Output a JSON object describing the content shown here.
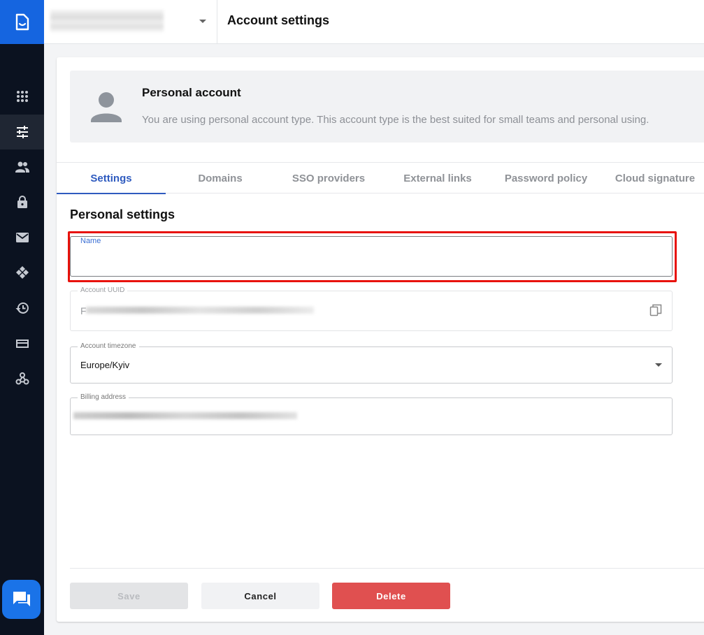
{
  "header": {
    "page_title": "Account settings",
    "org_select_caret": "caret-down-icon"
  },
  "sidebar": {
    "logo_icon": "document-logo-icon",
    "items": [
      {
        "icon": "apps-grid-icon",
        "active": false
      },
      {
        "icon": "settings-sliders-icon",
        "active": true
      },
      {
        "icon": "users-icon",
        "active": false
      },
      {
        "icon": "lock-icon",
        "active": false
      },
      {
        "icon": "mail-icon",
        "active": false
      },
      {
        "icon": "integrations-icon",
        "active": false
      },
      {
        "icon": "history-icon",
        "active": false
      },
      {
        "icon": "billing-card-icon",
        "active": false
      },
      {
        "icon": "webhook-icon",
        "active": false
      }
    ],
    "chat_icon": "chat-icon"
  },
  "banner": {
    "title": "Personal account",
    "description": "You are using personal account type. This account type is the best suited for small teams and personal using."
  },
  "tabs": [
    {
      "label": "Settings",
      "active": true
    },
    {
      "label": "Domains",
      "active": false
    },
    {
      "label": "SSO providers",
      "active": false
    },
    {
      "label": "External links",
      "active": false
    },
    {
      "label": "Password policy",
      "active": false
    },
    {
      "label": "Cloud signature",
      "active": false
    }
  ],
  "form": {
    "section_title": "Personal settings",
    "name": {
      "label": "Name",
      "value": ""
    },
    "uuid": {
      "label": "Account UUID",
      "value_prefix": "F"
    },
    "timezone": {
      "label": "Account timezone",
      "value": "Europe/Kyiv"
    },
    "billing": {
      "label": "Billing address"
    }
  },
  "actions": {
    "save": "Save",
    "cancel": "Cancel",
    "delete": "Delete"
  },
  "colors": {
    "accent": "#2f5bbf",
    "sidebar_bg": "#0b1220",
    "logo_bg": "#1565e0",
    "delete": "#e05050",
    "highlight": "#e8120c"
  }
}
